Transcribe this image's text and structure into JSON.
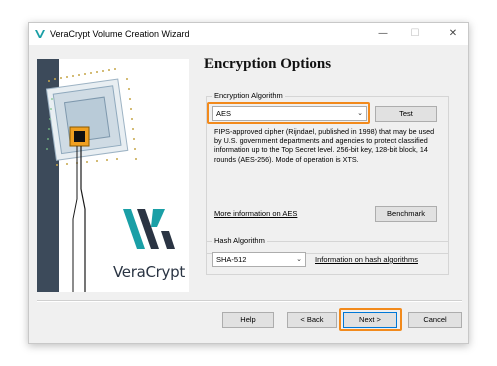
{
  "window": {
    "title": "VeraCrypt Volume Creation Wizard",
    "controls": {
      "minimize": "—",
      "maximize": "☐",
      "close": "✕"
    }
  },
  "branding": {
    "logo_text": "VeraCrypt"
  },
  "page": {
    "title": "Encryption Options"
  },
  "encryption": {
    "group_label": "Encryption Algorithm",
    "selected": "AES",
    "test_button": "Test",
    "description": "FIPS-approved cipher (Rijndael, published in 1998) that may be used by U.S. government departments and agencies to protect classified information up to the Top Secret level. 256-bit key, 128-bit block, 14 rounds (AES-256). Mode of operation is XTS.",
    "more_info_link": "More information on AES",
    "benchmark_button": "Benchmark"
  },
  "hash": {
    "group_label": "Hash Algorithm",
    "selected": "SHA-512",
    "info_link": "Information on hash algorithms"
  },
  "footer": {
    "help": "Help",
    "back": "< Back",
    "next": "Next >",
    "cancel": "Cancel"
  },
  "colors": {
    "highlight": "#f28a1c",
    "logo_teal": "#1a9fa6",
    "logo_dark": "#2a3443",
    "sidebar_dark": "#3c4a5a"
  }
}
